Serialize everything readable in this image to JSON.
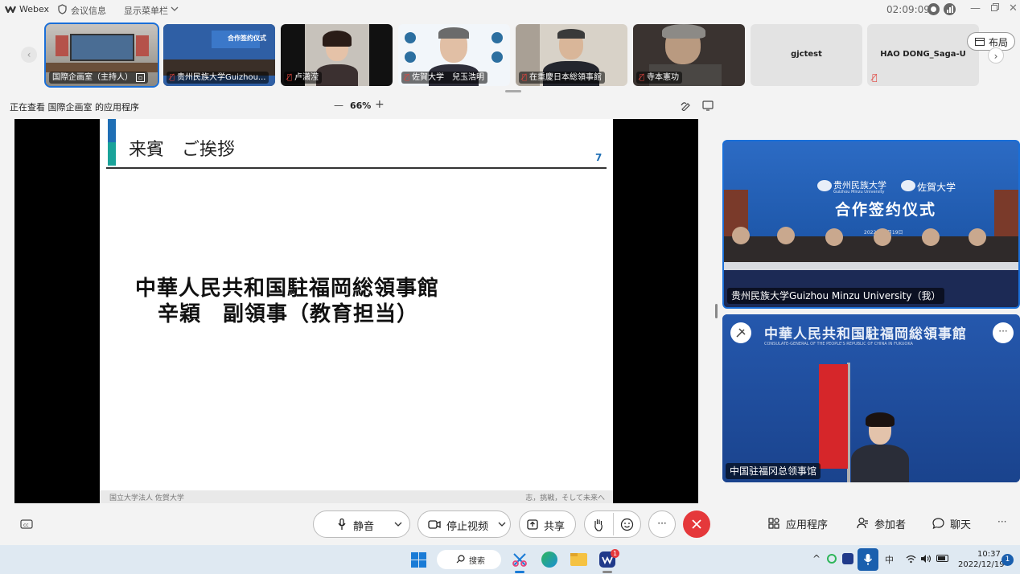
{
  "titlebar": {
    "app_name": "Webex",
    "meeting_info": "会议信息",
    "show_menu": "显示菜单栏",
    "timer": "02:09:09"
  },
  "participants": [
    {
      "name": "国際企画室（主持人）"
    },
    {
      "name": "贵州民族大学Guizhou..."
    },
    {
      "name": "卢潇滢"
    },
    {
      "name": "佐賀大学　兒玉浩明"
    },
    {
      "name": "在重慶日本総領事館"
    },
    {
      "name": "寺本憲功"
    },
    {
      "name": "gjctest"
    },
    {
      "name": "HAO DONG_Saga-U"
    }
  ],
  "layout_button": "布局",
  "viewing_text": "正在查看 国際企画室 的应用程序",
  "zoom": {
    "minus": "—",
    "value": "66%",
    "plus": "+"
  },
  "slide": {
    "header": "来賓　ご挨拶",
    "page_number": "7",
    "line1": "中華人民共和国駐福岡総領事館",
    "line2": "辛穎　副領事（教育担当）",
    "footer_left": "国立大学法人 佐賀大学",
    "footer_right": "志，挑戦，そして未来へ"
  },
  "video_self": {
    "label": "贵州民族大学Guizhou Minzu University（我）",
    "banner_title": "合作签约仪式",
    "logo_left": "贵州民族大学",
    "logo_left_sub": "Guizhou Minzu University",
    "logo_right": "佐賀大学",
    "date_text": "2022年12月19日"
  },
  "video_consulate": {
    "label": "中国驻福冈总领事馆",
    "banner_title": "中華人民共和国駐福岡総領事館",
    "banner_sub": "CONSULATE-GENERAL OF THE PEOPLE'S REPUBLIC OF CHINA IN FUKUOKA"
  },
  "controls": {
    "mute": "静音",
    "stop_video": "停止视频",
    "share": "共享",
    "apps": "应用程序",
    "participants": "参加者",
    "chat": "聊天",
    "more": "···"
  },
  "taskbar": {
    "search": "搜索",
    "ime": "中",
    "time": "10:37",
    "date": "2022/12/19",
    "notification_count": "1",
    "webex_badge": "1"
  },
  "colors": {
    "accent_blue": "#1a6fd8",
    "end_red": "#e5383b",
    "slide_blue": "#1f6fb5",
    "slide_teal": "#1aa39a"
  }
}
